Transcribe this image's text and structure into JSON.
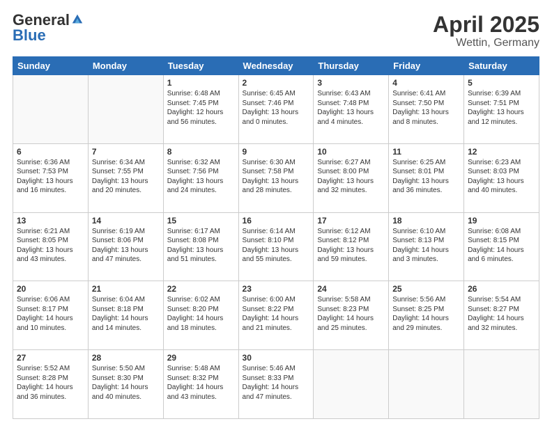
{
  "header": {
    "logo_general": "General",
    "logo_blue": "Blue",
    "title": "April 2025",
    "subtitle": "Wettin, Germany"
  },
  "weekdays": [
    "Sunday",
    "Monday",
    "Tuesday",
    "Wednesday",
    "Thursday",
    "Friday",
    "Saturday"
  ],
  "weeks": [
    [
      {
        "day": "",
        "info": ""
      },
      {
        "day": "",
        "info": ""
      },
      {
        "day": "1",
        "info": "Sunrise: 6:48 AM\nSunset: 7:45 PM\nDaylight: 12 hours and 56 minutes."
      },
      {
        "day": "2",
        "info": "Sunrise: 6:45 AM\nSunset: 7:46 PM\nDaylight: 13 hours and 0 minutes."
      },
      {
        "day": "3",
        "info": "Sunrise: 6:43 AM\nSunset: 7:48 PM\nDaylight: 13 hours and 4 minutes."
      },
      {
        "day": "4",
        "info": "Sunrise: 6:41 AM\nSunset: 7:50 PM\nDaylight: 13 hours and 8 minutes."
      },
      {
        "day": "5",
        "info": "Sunrise: 6:39 AM\nSunset: 7:51 PM\nDaylight: 13 hours and 12 minutes."
      }
    ],
    [
      {
        "day": "6",
        "info": "Sunrise: 6:36 AM\nSunset: 7:53 PM\nDaylight: 13 hours and 16 minutes."
      },
      {
        "day": "7",
        "info": "Sunrise: 6:34 AM\nSunset: 7:55 PM\nDaylight: 13 hours and 20 minutes."
      },
      {
        "day": "8",
        "info": "Sunrise: 6:32 AM\nSunset: 7:56 PM\nDaylight: 13 hours and 24 minutes."
      },
      {
        "day": "9",
        "info": "Sunrise: 6:30 AM\nSunset: 7:58 PM\nDaylight: 13 hours and 28 minutes."
      },
      {
        "day": "10",
        "info": "Sunrise: 6:27 AM\nSunset: 8:00 PM\nDaylight: 13 hours and 32 minutes."
      },
      {
        "day": "11",
        "info": "Sunrise: 6:25 AM\nSunset: 8:01 PM\nDaylight: 13 hours and 36 minutes."
      },
      {
        "day": "12",
        "info": "Sunrise: 6:23 AM\nSunset: 8:03 PM\nDaylight: 13 hours and 40 minutes."
      }
    ],
    [
      {
        "day": "13",
        "info": "Sunrise: 6:21 AM\nSunset: 8:05 PM\nDaylight: 13 hours and 43 minutes."
      },
      {
        "day": "14",
        "info": "Sunrise: 6:19 AM\nSunset: 8:06 PM\nDaylight: 13 hours and 47 minutes."
      },
      {
        "day": "15",
        "info": "Sunrise: 6:17 AM\nSunset: 8:08 PM\nDaylight: 13 hours and 51 minutes."
      },
      {
        "day": "16",
        "info": "Sunrise: 6:14 AM\nSunset: 8:10 PM\nDaylight: 13 hours and 55 minutes."
      },
      {
        "day": "17",
        "info": "Sunrise: 6:12 AM\nSunset: 8:12 PM\nDaylight: 13 hours and 59 minutes."
      },
      {
        "day": "18",
        "info": "Sunrise: 6:10 AM\nSunset: 8:13 PM\nDaylight: 14 hours and 3 minutes."
      },
      {
        "day": "19",
        "info": "Sunrise: 6:08 AM\nSunset: 8:15 PM\nDaylight: 14 hours and 6 minutes."
      }
    ],
    [
      {
        "day": "20",
        "info": "Sunrise: 6:06 AM\nSunset: 8:17 PM\nDaylight: 14 hours and 10 minutes."
      },
      {
        "day": "21",
        "info": "Sunrise: 6:04 AM\nSunset: 8:18 PM\nDaylight: 14 hours and 14 minutes."
      },
      {
        "day": "22",
        "info": "Sunrise: 6:02 AM\nSunset: 8:20 PM\nDaylight: 14 hours and 18 minutes."
      },
      {
        "day": "23",
        "info": "Sunrise: 6:00 AM\nSunset: 8:22 PM\nDaylight: 14 hours and 21 minutes."
      },
      {
        "day": "24",
        "info": "Sunrise: 5:58 AM\nSunset: 8:23 PM\nDaylight: 14 hours and 25 minutes."
      },
      {
        "day": "25",
        "info": "Sunrise: 5:56 AM\nSunset: 8:25 PM\nDaylight: 14 hours and 29 minutes."
      },
      {
        "day": "26",
        "info": "Sunrise: 5:54 AM\nSunset: 8:27 PM\nDaylight: 14 hours and 32 minutes."
      }
    ],
    [
      {
        "day": "27",
        "info": "Sunrise: 5:52 AM\nSunset: 8:28 PM\nDaylight: 14 hours and 36 minutes."
      },
      {
        "day": "28",
        "info": "Sunrise: 5:50 AM\nSunset: 8:30 PM\nDaylight: 14 hours and 40 minutes."
      },
      {
        "day": "29",
        "info": "Sunrise: 5:48 AM\nSunset: 8:32 PM\nDaylight: 14 hours and 43 minutes."
      },
      {
        "day": "30",
        "info": "Sunrise: 5:46 AM\nSunset: 8:33 PM\nDaylight: 14 hours and 47 minutes."
      },
      {
        "day": "",
        "info": ""
      },
      {
        "day": "",
        "info": ""
      },
      {
        "day": "",
        "info": ""
      }
    ]
  ]
}
